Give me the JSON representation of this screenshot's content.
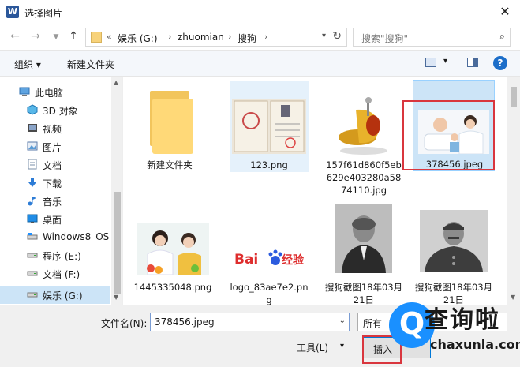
{
  "window": {
    "title": "选择图片",
    "app_icon": "W"
  },
  "nav": {
    "address": {
      "prefix": "«",
      "segments": [
        "娱乐 (G:)",
        "zhuomian",
        "搜狗"
      ]
    },
    "search_placeholder": "搜索\"搜狗\""
  },
  "toolbar": {
    "organize": "组织 ▾",
    "new_folder": "新建文件夹"
  },
  "sidebar": {
    "items": [
      {
        "label": "此电脑",
        "icon": "computer-icon"
      },
      {
        "label": "3D 对象",
        "icon": "cube-icon"
      },
      {
        "label": "视频",
        "icon": "video-icon"
      },
      {
        "label": "图片",
        "icon": "picture-icon"
      },
      {
        "label": "文档",
        "icon": "document-icon"
      },
      {
        "label": "下载",
        "icon": "download-icon"
      },
      {
        "label": "音乐",
        "icon": "music-icon"
      },
      {
        "label": "桌面",
        "icon": "desktop-icon"
      },
      {
        "label": "Windows8_OS",
        "icon": "drive-icon"
      },
      {
        "label": "程序 (E:)",
        "icon": "drive-icon"
      },
      {
        "label": "文档 (F:)",
        "icon": "drive-icon"
      },
      {
        "label": "娱乐 (G:)",
        "icon": "drive-icon"
      }
    ],
    "selected_index": 11
  },
  "files": [
    {
      "name": "新建文件夹",
      "kind": "folder"
    },
    {
      "name": "123.png",
      "kind": "certificate"
    },
    {
      "name": "157f61d860f5eb629e403280a5874110.jpg",
      "kind": "gold"
    },
    {
      "name": "378456.jpeg",
      "kind": "doctor"
    },
    {
      "name": "1445335048.png",
      "kind": "nurse"
    },
    {
      "name": "logo_83ae7e2.png",
      "kind": "baidu",
      "logo_text_a": "Bai",
      "logo_text_b": "经验"
    },
    {
      "name": "搜狗截图18年03月21日",
      "kind": "portrait1"
    },
    {
      "name": "搜狗截图18年03月21日",
      "kind": "portrait2"
    }
  ],
  "bottom": {
    "filename_label": "文件名(N):",
    "filename_value": "378456.jpeg",
    "filter_text": "所有",
    "tools_label": "工具(L)",
    "insert_label": "插入"
  },
  "watermark": {
    "logo": "Q",
    "text": "查询啦",
    "url": "chaxunla.com"
  },
  "colors": {
    "accent": "#0078d7",
    "selection": "#cce4f7",
    "highlight": "#d9363e",
    "watermark": "#1a90ff"
  }
}
